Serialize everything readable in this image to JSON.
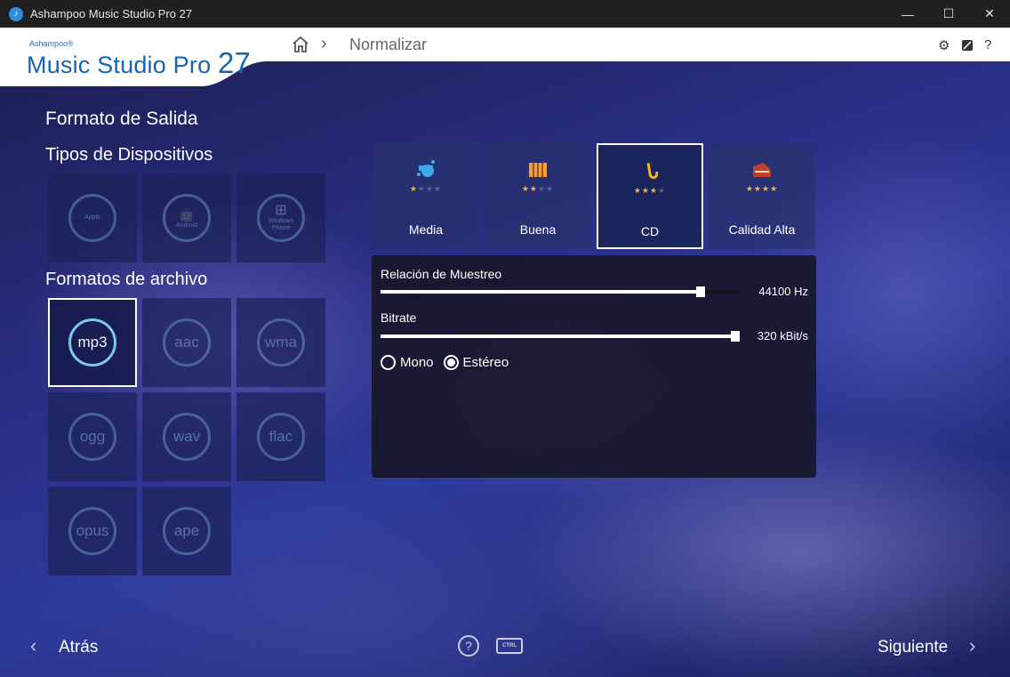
{
  "window": {
    "title": "Ashampoo Music Studio Pro 27",
    "controls": [
      "—",
      "☐",
      "✕"
    ]
  },
  "header": {
    "logo_small": "Ashampoo®",
    "logo_main": "Music Studio Pro",
    "logo_version": "27",
    "breadcrumb": "Normalizar",
    "icons": [
      "gear-icon",
      "skin-icon",
      "help-icon"
    ]
  },
  "left": {
    "output_title": "Formato de Salida",
    "devices_title": "Tipos de Dispositivos",
    "devices": [
      {
        "label": "Apple",
        "glyph": ""
      },
      {
        "label": "Android",
        "glyph": "🤖"
      },
      {
        "label": "Windows Phone",
        "glyph": "⊞"
      }
    ],
    "formats_title": "Formatos de archivo",
    "formats": [
      "mp3",
      "aac",
      "wma",
      "ogg",
      "wav",
      "flac",
      "opus",
      "ape"
    ],
    "selected_format": "mp3"
  },
  "quality": {
    "tiles": [
      {
        "label": "Media",
        "stars": 1,
        "icon": "whistle-icon",
        "color": "#3fa9ef"
      },
      {
        "label": "Buena",
        "stars": 2,
        "icon": "xylophone-icon",
        "color": "#f0a040"
      },
      {
        "label": "CD",
        "stars": 3,
        "icon": "saxophone-icon",
        "color": "#f6b820"
      },
      {
        "label": "Calidad Alta",
        "stars": 4,
        "icon": "piano-icon",
        "color": "#c04030"
      }
    ],
    "selected": "CD"
  },
  "settings": {
    "sample_rate_label": "Relación de Muestreo",
    "sample_rate_value": "44100 Hz",
    "sample_rate_fraction": 0.9,
    "bitrate_label": "Bitrate",
    "bitrate_value": "320 kBit/s",
    "bitrate_fraction": 1.0,
    "mono_label": "Mono",
    "stereo_label": "Estéreo",
    "channel": "stereo"
  },
  "footer": {
    "back": "Atrás",
    "next": "Siguiente",
    "ctrl": "CTRL"
  }
}
